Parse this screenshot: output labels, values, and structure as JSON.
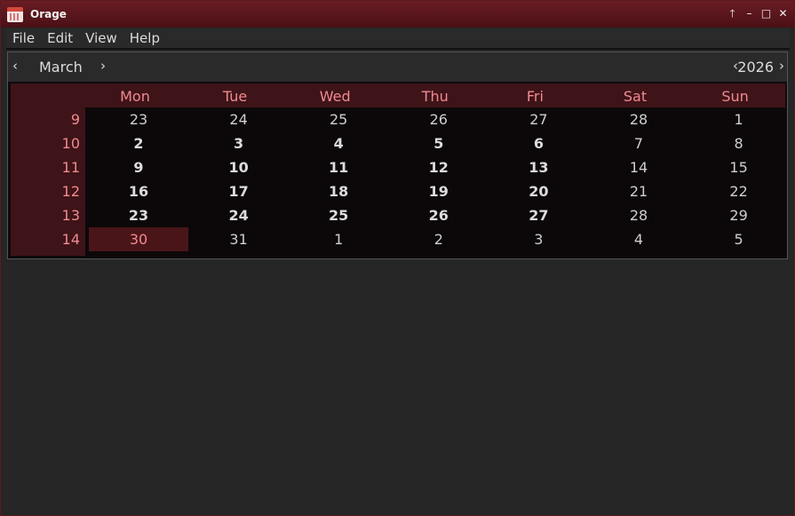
{
  "window": {
    "title": "Orage"
  },
  "wm": {
    "raise": "🡑",
    "minimize": "–",
    "maximize": "□",
    "close": "✕"
  },
  "menu": [
    "File",
    "Edit",
    "View",
    "Help"
  ],
  "nav": {
    "prev_month": "‹",
    "month": "March",
    "next_month": "›",
    "prev_year": "‹",
    "year": "2026",
    "next_year": "›"
  },
  "calendar": {
    "day_headers": [
      "Mon",
      "Tue",
      "Wed",
      "Thu",
      "Fri",
      "Sat",
      "Sun"
    ],
    "weeks": [
      {
        "num": "9",
        "days": [
          "23",
          "24",
          "25",
          "26",
          "27",
          "28",
          "1"
        ],
        "bold": [
          false,
          false,
          false,
          false,
          false,
          false,
          false
        ]
      },
      {
        "num": "10",
        "days": [
          "2",
          "3",
          "4",
          "5",
          "6",
          "7",
          "8"
        ],
        "bold": [
          true,
          true,
          true,
          true,
          true,
          false,
          false
        ]
      },
      {
        "num": "11",
        "days": [
          "9",
          "10",
          "11",
          "12",
          "13",
          "14",
          "15"
        ],
        "bold": [
          true,
          true,
          true,
          true,
          true,
          false,
          false
        ]
      },
      {
        "num": "12",
        "days": [
          "16",
          "17",
          "18",
          "19",
          "20",
          "21",
          "22"
        ],
        "bold": [
          true,
          true,
          true,
          true,
          true,
          false,
          false
        ]
      },
      {
        "num": "13",
        "days": [
          "23",
          "24",
          "25",
          "26",
          "27",
          "28",
          "29"
        ],
        "bold": [
          true,
          true,
          true,
          true,
          true,
          false,
          false
        ]
      },
      {
        "num": "14",
        "days": [
          "30",
          "31",
          "1",
          "2",
          "3",
          "4",
          "5"
        ],
        "bold": [
          false,
          false,
          false,
          false,
          false,
          false,
          false
        ]
      }
    ],
    "today": {
      "week": 5,
      "day": 0
    }
  },
  "colors": {
    "accent": "#f08a90",
    "header_bg": "#3e1419",
    "titlebar": "#5a141b"
  }
}
